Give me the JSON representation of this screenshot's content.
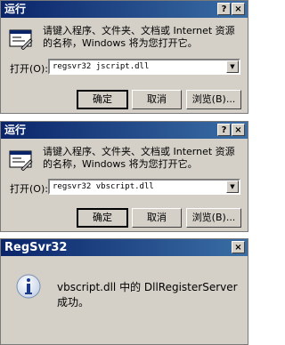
{
  "run1": {
    "title": "运行",
    "help": "?",
    "close": "×",
    "prompt": "请键入程序、文件夹、文档或 Internet 资源的名称，Windows 将为您打开它。",
    "open_label": "打开(O):",
    "command": "regsvr32 jscript.dll",
    "ok": "确定",
    "cancel": "取消",
    "browse": "浏览(B)..."
  },
  "run2": {
    "title": "运行",
    "help": "?",
    "close": "×",
    "prompt": "请键入程序、文件夹、文档或 Internet 资源的名称，Windows 将为您打开它。",
    "open_label": "打开(O):",
    "command": "regsvr32 vbscript.dll",
    "ok": "确定",
    "cancel": "取消",
    "browse": "浏览(B)..."
  },
  "regsvr": {
    "title": "RegSvr32",
    "close": "×",
    "message": "vbscript.dll 中的 DllRegisterServer 成功。"
  },
  "icons": [
    "run-icon",
    "info-icon",
    "help-icon",
    "close-icon",
    "dropdown-arrow-icon"
  ]
}
